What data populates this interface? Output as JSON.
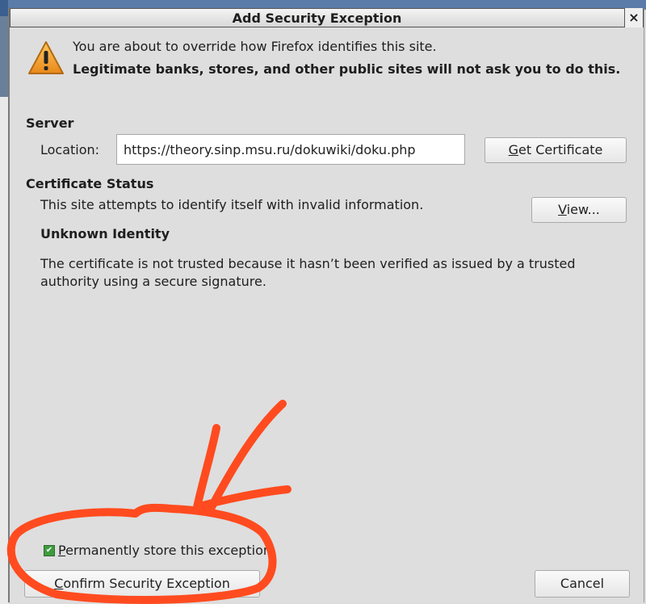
{
  "dialog": {
    "title": "Add Security Exception",
    "close_glyph": "×",
    "intro_line1": "You are about to override how Firefox identifies this site.",
    "intro_warning": "Legitimate banks, stores, and other public sites will not ask you to do this."
  },
  "server": {
    "heading": "Server",
    "location_label": "Location:",
    "location_value": "https://theory.sinp.msu.ru/dokuwiki/doku.php",
    "get_certificate_mnemonic": "G",
    "get_certificate_rest": "et Certificate"
  },
  "certificate_status": {
    "heading": "Certificate Status",
    "invalid_info": "This site attempts to identify itself with invalid information.",
    "view_mnemonic": "V",
    "view_rest": "iew...",
    "identity_heading": "Unknown Identity",
    "identity_detail": "The certificate is not trusted because it hasn’t been verified as issued by a trusted authority using a secure signature."
  },
  "footer": {
    "permanent_store_mnemonic": "P",
    "permanent_store_rest": "ermanently store this exception",
    "permanent_store_checked": true,
    "confirm_mnemonic": "C",
    "confirm_rest": "onfirm Security Exception",
    "cancel_label": "Cancel"
  },
  "icons": {
    "warning": "warning-triangle-icon",
    "checkbox": "checkmark-icon"
  },
  "colors": {
    "warning_fill": "#f0a030",
    "annotation": "#ff4b1f",
    "checkbox_fill": "#3f9b3f"
  }
}
